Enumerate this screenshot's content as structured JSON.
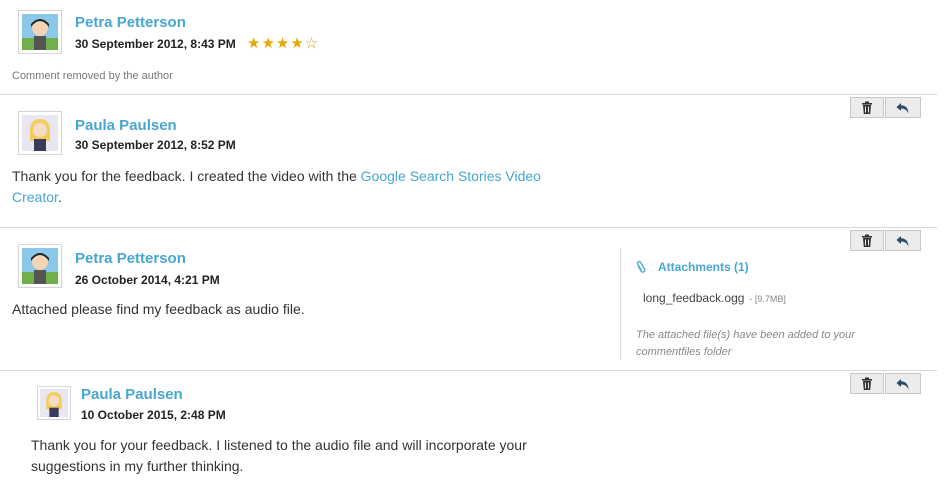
{
  "comments": [
    {
      "author": "Petra Petterson",
      "date": "30 September 2012, 8:43 PM",
      "rating": 4,
      "stars": "★★★★",
      "empty_stars": "☆",
      "note": "Comment removed by the author"
    },
    {
      "author": "Paula Paulsen",
      "date": "30 September 2012, 8:52 PM",
      "text_before": "Thank you for the feedback. I created the video with the ",
      "link_text": "Google Search Stories Video Creator",
      "text_after": "."
    },
    {
      "author": "Petra Petterson",
      "date": "26 October 2014, 4:21 PM",
      "text": "Attached please find my feedback as audio file.",
      "attachments": {
        "title": "Attachments (1)",
        "file_name": "long_feedback.ogg",
        "file_size": "- [9.7MB]",
        "note": "The attached file(s) have been added to your commentfiles folder"
      }
    },
    {
      "author": "Paula Paulsen",
      "date": "10 October 2015, 2:48 PM",
      "text": "Thank you for your feedback. I listened to the audio file and will incorporate your suggestions in my further thinking."
    }
  ],
  "icons": {
    "delete": "trash-icon",
    "reply": "reply-icon",
    "attachment": "paperclip-icon"
  },
  "colors": {
    "accent": "#47a7cf",
    "star": "#e6a800",
    "divider": "#d9d9d9"
  }
}
